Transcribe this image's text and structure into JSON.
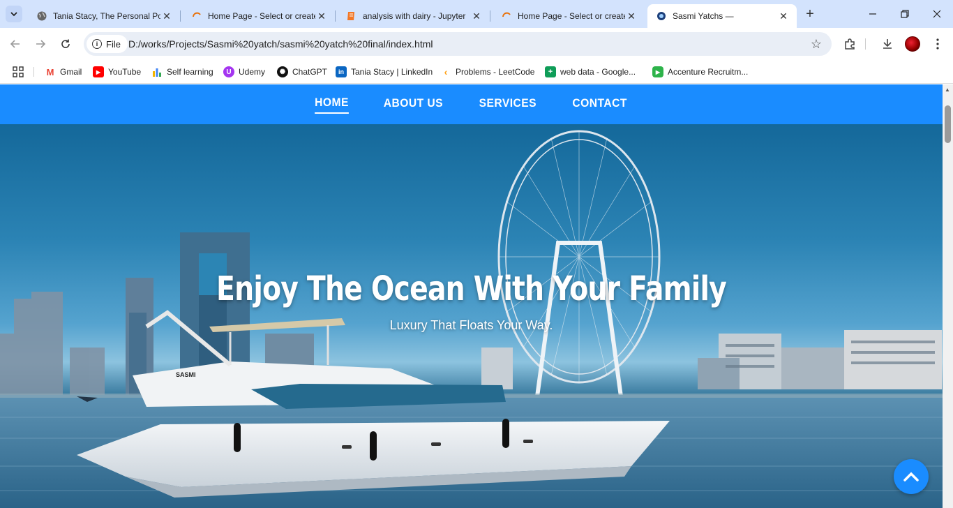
{
  "browser": {
    "tabs": [
      {
        "title": "Tania Stacy, The Personal Por",
        "icon": "globe-icon"
      },
      {
        "title": "Home Page - Select or create",
        "icon": "loading-icon"
      },
      {
        "title": "analysis with dairy - Jupyter",
        "icon": "notebook-icon"
      },
      {
        "title": "Home Page - Select or create",
        "icon": "loading-icon"
      },
      {
        "title": "Sasmi Yatchs —",
        "icon": "site-logo-icon",
        "active": true
      }
    ],
    "address": {
      "chip_label": "File",
      "url": "D:/works/Projects/Sasmi%20yatch/sasmi%20yatch%20final/index.html"
    },
    "bookmarks": [
      {
        "label": "Gmail",
        "icon": "gmail-icon",
        "color": "#ea4335"
      },
      {
        "label": "YouTube",
        "icon": "youtube-icon",
        "color": "#ff0000"
      },
      {
        "label": "Self learning",
        "icon": "bar-chart-icon",
        "color": "#f4b400"
      },
      {
        "label": "Udemy",
        "icon": "udemy-icon",
        "color": "#a435f0"
      },
      {
        "label": "ChatGPT",
        "icon": "chatgpt-icon",
        "color": "#111111"
      },
      {
        "label": "Tania Stacy | LinkedIn",
        "icon": "linkedin-icon",
        "color": "#0a66c2"
      },
      {
        "label": "Problems - LeetCode",
        "icon": "leetcode-icon",
        "color": "#ffa116"
      },
      {
        "label": "web data - Google...",
        "icon": "sheets-icon",
        "color": "#0f9d58"
      },
      {
        "label": "Accenture Recruitm...",
        "icon": "accenture-icon",
        "color": "#2db34a"
      }
    ]
  },
  "site": {
    "nav": [
      {
        "label": "HOME",
        "active": true
      },
      {
        "label": "ABOUT US"
      },
      {
        "label": "SERVICES"
      },
      {
        "label": "CONTACT"
      }
    ],
    "hero": {
      "title": "Enjoy The Ocean With Your Family",
      "subtitle": "Luxury That Floats Your Way.",
      "yacht_name": "SASMI"
    },
    "accent_color": "#1a8cff"
  }
}
